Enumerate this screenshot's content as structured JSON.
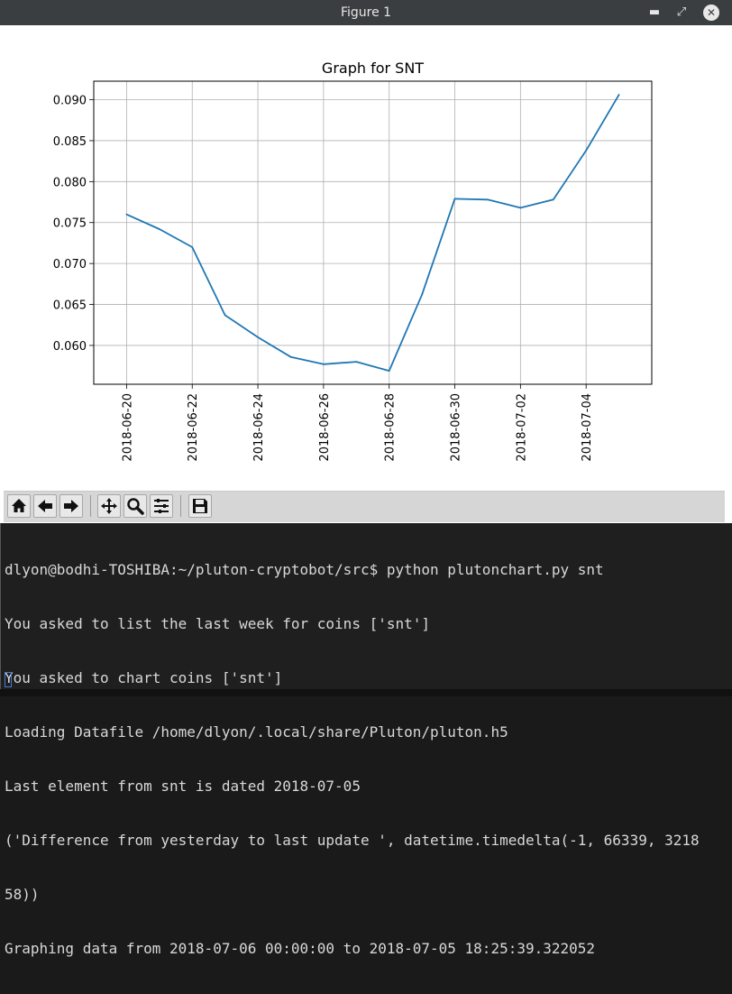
{
  "window": {
    "title": "Figure 1",
    "minimize_label": "▬",
    "maximize_label": "⤢",
    "close_label": "✕"
  },
  "toolbar": {
    "icons": [
      "home-icon",
      "back-arrow-icon",
      "forward-arrow-icon",
      "pan-icon",
      "zoom-icon",
      "subplots-icon",
      "save-icon"
    ]
  },
  "chart_data": {
    "type": "line",
    "title": "Graph for SNT",
    "xlabel": "",
    "ylabel": "",
    "x": [
      "2018-06-20",
      "2018-06-21",
      "2018-06-22",
      "2018-06-23",
      "2018-06-24",
      "2018-06-25",
      "2018-06-26",
      "2018-06-27",
      "2018-06-28",
      "2018-06-29",
      "2018-06-30",
      "2018-07-01",
      "2018-07-02",
      "2018-07-03",
      "2018-07-04",
      "2018-07-05"
    ],
    "series": [
      {
        "values": [
          0.076,
          0.0742,
          0.072,
          0.0637,
          0.061,
          0.0586,
          0.0577,
          0.058,
          0.0569,
          0.0662,
          0.0779,
          0.0778,
          0.0768,
          0.0778,
          0.0838,
          0.0906
        ],
        "color": "#1f77b4"
      }
    ],
    "xticks": [
      "2018-06-20",
      "2018-06-22",
      "2018-06-24",
      "2018-06-26",
      "2018-06-28",
      "2018-06-30",
      "2018-07-02",
      "2018-07-04"
    ],
    "yticks": [
      "0.060",
      "0.065",
      "0.070",
      "0.075",
      "0.080",
      "0.085",
      "0.090"
    ],
    "ytick_values": [
      0.06,
      0.065,
      0.07,
      0.075,
      0.08,
      0.085,
      0.09
    ],
    "ylim": [
      0.05526,
      0.09226
    ],
    "xlim": [
      "2018-06-19",
      "2018-07-06"
    ],
    "grid": true
  },
  "terminal": {
    "lines": [
      "dlyon@bodhi-TOSHIBA:~/pluton-cryptobot/src$ python plutonchart.py snt",
      "You asked to list the last week for coins ['snt']",
      "You asked to chart coins ['snt']",
      "Loading Datafile /home/dlyon/.local/share/Pluton/pluton.h5",
      "Last element from snt is dated 2018-07-05",
      "('Difference from yesterday to last update ', datetime.timedelta(-1, 66339, 3218",
      "58))",
      "Graphing data from 2018-07-06 00:00:00 to 2018-07-05 18:25:39.322052"
    ]
  }
}
